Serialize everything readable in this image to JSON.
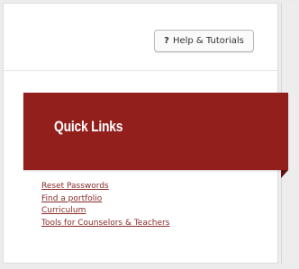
{
  "header": {
    "help_button": {
      "icon": "question-icon",
      "icon_glyph": "?",
      "label": "Help & Tutorials"
    }
  },
  "quick_links": {
    "title": "Quick Links",
    "accent_color": "#931f1d",
    "links": [
      {
        "label": "Reset Passwords"
      },
      {
        "label": "Find a portfolio"
      },
      {
        "label": "Curriculum"
      },
      {
        "label": "Tools for Counselors & Teachers"
      }
    ]
  }
}
